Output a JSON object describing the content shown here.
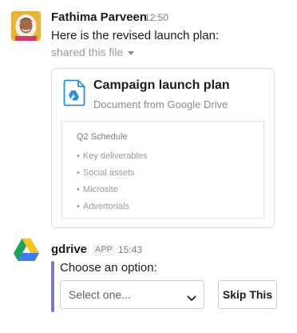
{
  "message1": {
    "author": "Fathima Parveen",
    "time": "12:50",
    "text": "Here is the revised launch plan:",
    "shared_label": "shared this file",
    "file": {
      "title": "Campaign launch plan",
      "subtitle": "Document from Google Drive",
      "icon": "google-docs-icon",
      "preview": {
        "heading": "Q2 Schedule",
        "items": [
          "Key deliverables",
          "Social assets",
          "Microsite",
          "Advertorials"
        ]
      }
    }
  },
  "message2": {
    "author": "gdrive",
    "badge": "APP",
    "time": "15:43",
    "attachment": {
      "prompt": "Choose an option:",
      "select": {
        "value": "Select one..."
      },
      "button_label": "Skip This",
      "accent_color": "#7c7bbd"
    }
  }
}
